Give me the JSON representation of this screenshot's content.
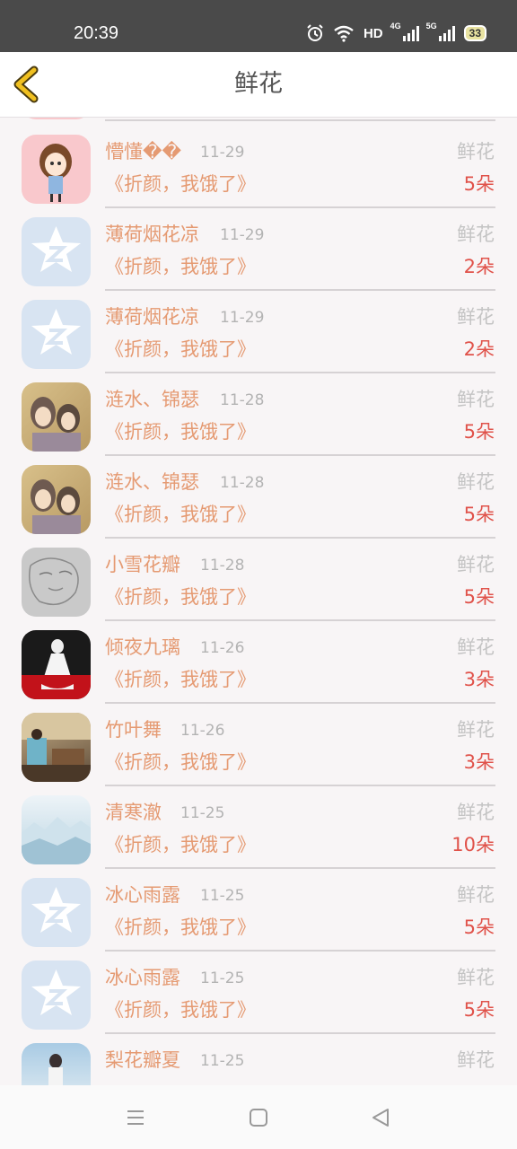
{
  "status_bar": {
    "time": "20:39",
    "hd_label": "HD",
    "net1": "4G",
    "net2": "5G",
    "battery": "33",
    "icons": [
      "alarm-icon",
      "wifi-icon",
      "signal-icon",
      "signal-icon",
      "battery-icon"
    ]
  },
  "header": {
    "title": "鲜花",
    "back_icon": "chevron-left-icon"
  },
  "items": [
    {
      "name": "懵懂��",
      "date": "11-29",
      "gift": "鲜花",
      "book": "《折颜，我饿了》",
      "count": "5朵",
      "avatar": "cartoon-girl"
    },
    {
      "name": "薄荷烟花凉",
      "date": "11-29",
      "gift": "鲜花",
      "book": "《折颜，我饿了》",
      "count": "2朵",
      "avatar": "default-star"
    },
    {
      "name": "薄荷烟花凉",
      "date": "11-29",
      "gift": "鲜花",
      "book": "《折颜，我饿了》",
      "count": "2朵",
      "avatar": "default-star"
    },
    {
      "name": "涟水、锦瑟",
      "date": "11-28",
      "gift": "鲜花",
      "book": "《折颜，我饿了》",
      "count": "5朵",
      "avatar": "anime-pair"
    },
    {
      "name": "涟水、锦瑟",
      "date": "11-28",
      "gift": "鲜花",
      "book": "《折颜，我饿了》",
      "count": "5朵",
      "avatar": "anime-pair"
    },
    {
      "name": "小雪花瓣",
      "date": "11-28",
      "gift": "鲜花",
      "book": "《折颜，我饿了》",
      "count": "5朵",
      "avatar": "sketch"
    },
    {
      "name": "倾夜九璃",
      "date": "11-26",
      "gift": "鲜花",
      "book": "《折颜，我饿了》",
      "count": "3朵",
      "avatar": "white-dress-red"
    },
    {
      "name": "竹叶舞",
      "date": "11-26",
      "gift": "鲜花",
      "book": "《折颜，我饿了》",
      "count": "3朵",
      "avatar": "room-photo"
    },
    {
      "name": "清寒澈",
      "date": "11-25",
      "gift": "鲜花",
      "book": "《折颜，我饿了》",
      "count": "10朵",
      "avatar": "ice-landscape"
    },
    {
      "name": "冰心雨露",
      "date": "11-25",
      "gift": "鲜花",
      "book": "《折颜，我饿了》",
      "count": "5朵",
      "avatar": "default-star"
    },
    {
      "name": "冰心雨露",
      "date": "11-25",
      "gift": "鲜花",
      "book": "《折颜，我饿了》",
      "count": "5朵",
      "avatar": "default-star"
    },
    {
      "name": "梨花瓣夏",
      "date": "11-25",
      "gift": "鲜花",
      "book": "",
      "count": "",
      "avatar": "girl-photo"
    }
  ],
  "nav": {
    "icons": [
      "menu-icon",
      "home-icon",
      "back-triangle-icon"
    ]
  },
  "colors": {
    "accent": "#e59a72",
    "count": "#e0524a",
    "muted": "#b3b3b3",
    "back_arrow": "#e8b400"
  }
}
